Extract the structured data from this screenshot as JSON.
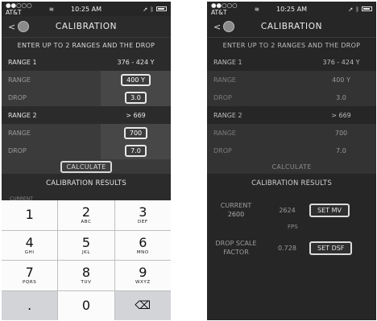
{
  "status": {
    "carrier": "●●○○○ AT&T",
    "time": "10:25 AM"
  },
  "header": {
    "back": "<",
    "title": "CALIBRATION"
  },
  "instruction": "ENTER UP TO 2 RANGES AND THE DROP",
  "range1": {
    "label": "RANGE 1",
    "value": "376 - 424 Y"
  },
  "range1_range": {
    "label": "RANGE",
    "value": "400 Y"
  },
  "range1_drop": {
    "label": "DROP",
    "value": "3.0"
  },
  "range2": {
    "label": "RANGE 2",
    "value": "> 669"
  },
  "range2_range": {
    "label": "RANGE",
    "value": "700"
  },
  "range2_drop": {
    "label": "DROP",
    "value": "7.0"
  },
  "calculate": "CALCULATE",
  "results_title": "CALIBRATION RESULTS",
  "keypad_peek": "CURRENT",
  "keypad": [
    {
      "num": "1",
      "letters": ""
    },
    {
      "num": "2",
      "letters": "ABC"
    },
    {
      "num": "3",
      "letters": "DEF"
    },
    {
      "num": "4",
      "letters": "GHI"
    },
    {
      "num": "5",
      "letters": "JKL"
    },
    {
      "num": "6",
      "letters": "MNO"
    },
    {
      "num": "7",
      "letters": "PQRS"
    },
    {
      "num": "8",
      "letters": "TUV"
    },
    {
      "num": "9",
      "letters": "WXYZ"
    },
    {
      "num": ".",
      "letters": ""
    },
    {
      "num": "0",
      "letters": ""
    },
    {
      "num": "⌫",
      "letters": ""
    }
  ],
  "results": {
    "current_label_1": "CURRENT",
    "current_label_2": "2600",
    "current_value": "2624",
    "fps": "FPS",
    "set_mv": "SET MV",
    "dsf_label_1": "DROP SCALE",
    "dsf_label_2": "FACTOR",
    "dsf_value": "0.728",
    "set_dsf": "SET DSF"
  }
}
